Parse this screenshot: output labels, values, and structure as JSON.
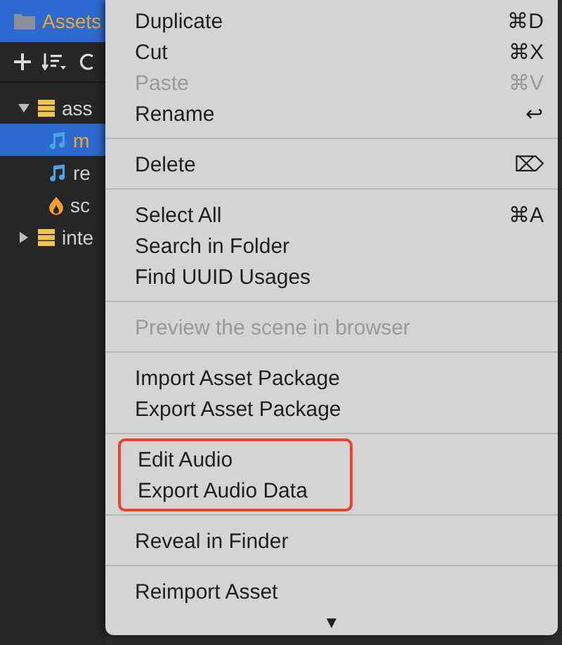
{
  "panel": {
    "title": "Assets",
    "tree": [
      {
        "label": "ass",
        "kind": "database",
        "expanded": true,
        "selected": false,
        "children": [
          {
            "label": "m",
            "kind": "audio",
            "selected": true
          },
          {
            "label": "re",
            "kind": "audio",
            "selected": false
          },
          {
            "label": "sc",
            "kind": "script",
            "selected": false
          }
        ]
      },
      {
        "label": "inte",
        "kind": "database",
        "expanded": false,
        "selected": false
      }
    ]
  },
  "menu": {
    "groups": [
      {
        "highlighted": false,
        "items": [
          {
            "label": "Duplicate",
            "shortcut": "⌘D",
            "disabled": false
          },
          {
            "label": "Cut",
            "shortcut": "⌘X",
            "disabled": false
          },
          {
            "label": "Paste",
            "shortcut": "⌘V",
            "disabled": true
          },
          {
            "label": "Rename",
            "shortcut": "↩",
            "disabled": false
          }
        ]
      },
      {
        "highlighted": false,
        "items": [
          {
            "label": "Delete",
            "shortcut": "⌦",
            "disabled": false
          }
        ]
      },
      {
        "highlighted": false,
        "items": [
          {
            "label": "Select All",
            "shortcut": "⌘A",
            "disabled": false
          },
          {
            "label": "Search in Folder",
            "disabled": false
          },
          {
            "label": "Find UUID Usages",
            "disabled": false
          }
        ]
      },
      {
        "highlighted": false,
        "items": [
          {
            "label": "Preview the scene in browser",
            "disabled": true
          }
        ]
      },
      {
        "highlighted": false,
        "items": [
          {
            "label": "Import Asset Package",
            "disabled": false
          },
          {
            "label": "Export Asset Package",
            "disabled": false
          }
        ]
      },
      {
        "highlighted": true,
        "items": [
          {
            "label": "Edit Audio",
            "disabled": false
          },
          {
            "label": "Export Audio Data",
            "disabled": false
          }
        ]
      },
      {
        "highlighted": false,
        "items": [
          {
            "label": "Reveal in Finder",
            "disabled": false
          }
        ]
      },
      {
        "highlighted": false,
        "items": [
          {
            "label": "Reimport Asset",
            "disabled": false
          }
        ]
      }
    ],
    "more": "▼"
  }
}
